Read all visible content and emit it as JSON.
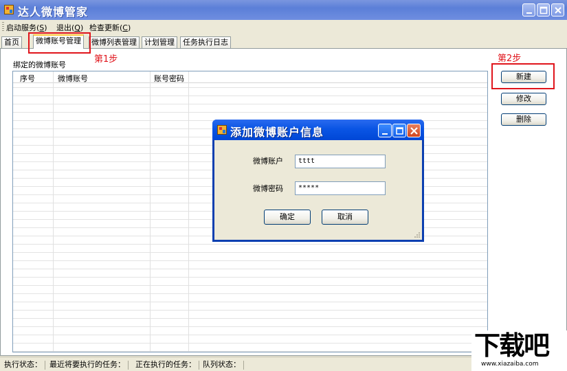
{
  "window": {
    "title": "达人微博管家"
  },
  "menu": [
    {
      "label": "启动服务(",
      "key": "S",
      "suffix": ")"
    },
    {
      "label": "退出(",
      "key": "Q",
      "suffix": ")"
    },
    {
      "label": "检查更新(",
      "key": "C",
      "suffix": ")"
    }
  ],
  "tabs": [
    "首页",
    "微博账号管理",
    "微博列表管理",
    "计划管理",
    "任务执行日志"
  ],
  "active_tab": "微博账号管理",
  "groupbox_label": "绑定的微博账号",
  "table": {
    "columns": [
      "序号",
      "微博账号",
      "账号密码"
    ],
    "rows": []
  },
  "buttons": {
    "new": "新建",
    "edit": "修改",
    "delete": "删除"
  },
  "annotations": {
    "step1": "第1步",
    "step2": "第2步",
    "color": "#e0141b"
  },
  "dialog": {
    "title": "添加微博账户信息",
    "account_label": "微博账户",
    "account_value": "tttt",
    "password_label": "微博密码",
    "password_value": "*****",
    "ok": "确定",
    "cancel": "取消"
  },
  "status": [
    "执行状态：",
    "最近将要执行的任务：",
    "正在执行的任务：",
    "队列状态："
  ],
  "watermark": {
    "big": "下载吧",
    "small": "www.xiazaiba.com"
  }
}
